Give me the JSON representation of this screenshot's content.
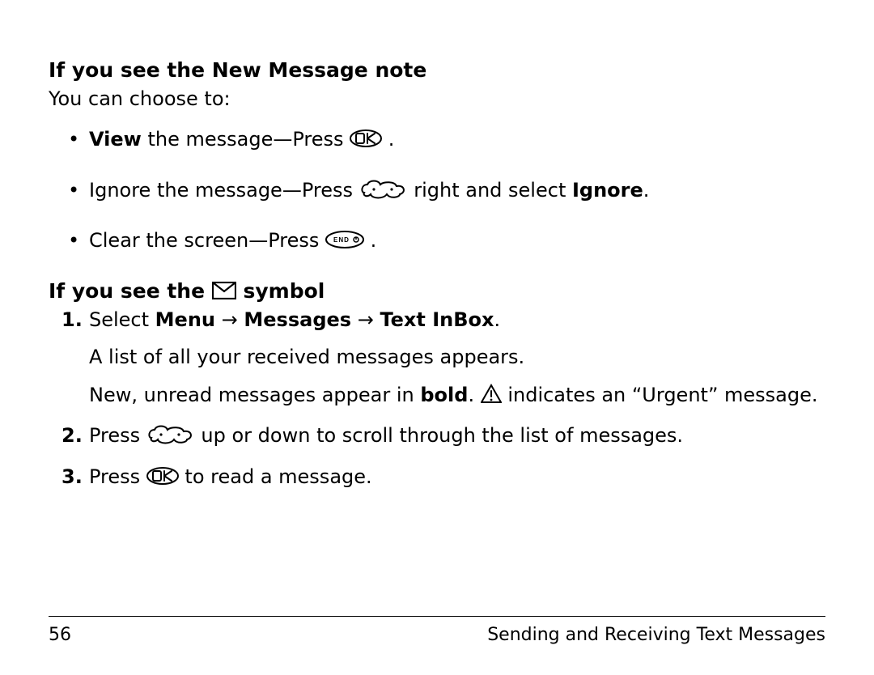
{
  "section1": {
    "heading": "If you see the New Message note",
    "intro": "You can choose to:",
    "bullets": {
      "b1": {
        "pre_bold": "View",
        "pre_rest": " the message—Press ",
        "post": " ."
      },
      "b2": {
        "pre": "Ignore the message—Press ",
        "mid": " right and select ",
        "bold": "Ignore",
        "end": "."
      },
      "b3": {
        "pre": "Clear the screen—Press ",
        "post": " ."
      }
    }
  },
  "section2": {
    "heading_pre": "If you see the ",
    "heading_post": " symbol",
    "steps": {
      "s1": {
        "pre": "Select ",
        "m1": "Menu",
        "arrow1": " → ",
        "m2": "Messages",
        "arrow2": " → ",
        "m3": "Text InBox",
        "end": ".",
        "line2": "A list of all your received messages appears.",
        "line3_pre": "New, unread messages appear in ",
        "line3_bold": "bold",
        "line3_mid": ". ",
        "line3_post": " indicates an “Urgent” message."
      },
      "s2": {
        "pre": "Press ",
        "post": " up or down to scroll through the list of messages."
      },
      "s3": {
        "pre": "Press ",
        "post": " to read a message."
      }
    }
  },
  "footer": {
    "page": "56",
    "title": "Sending and Receiving Text Messages"
  }
}
